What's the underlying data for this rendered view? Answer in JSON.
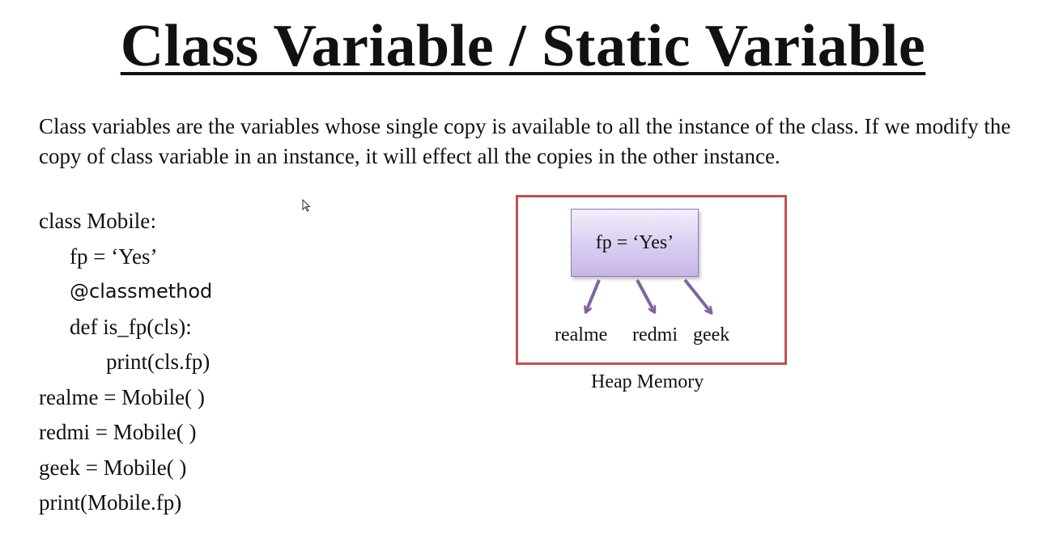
{
  "title": "Class Variable / Static Variable",
  "description": "Class variables are the variables whose single copy is available to all the instance of the class. If we modify the copy of class variable in an instance, it will effect all the copies in the other instance.",
  "code": {
    "line1_prefix": "class Mobile",
    "line1_colon": ":",
    "line2": "fp = ‘Yes’",
    "line3": "@classmethod",
    "line4": "def is_fp(cls):",
    "line5": "print(cls.fp)",
    "line6": "realme = Mobile( )",
    "line7": "redmi = Mobile( )",
    "line8": "geek = Mobile( )",
    "line9": "print(Mobile.fp)"
  },
  "diagram": {
    "box_text": "fp = ‘Yes’",
    "objects": [
      "realme",
      "redmi",
      "geek"
    ],
    "caption": "Heap Memory",
    "colors": {
      "heap_border": "#c0504d",
      "box_fill": "#d9cdf0",
      "arrow": "#8064a2"
    }
  }
}
